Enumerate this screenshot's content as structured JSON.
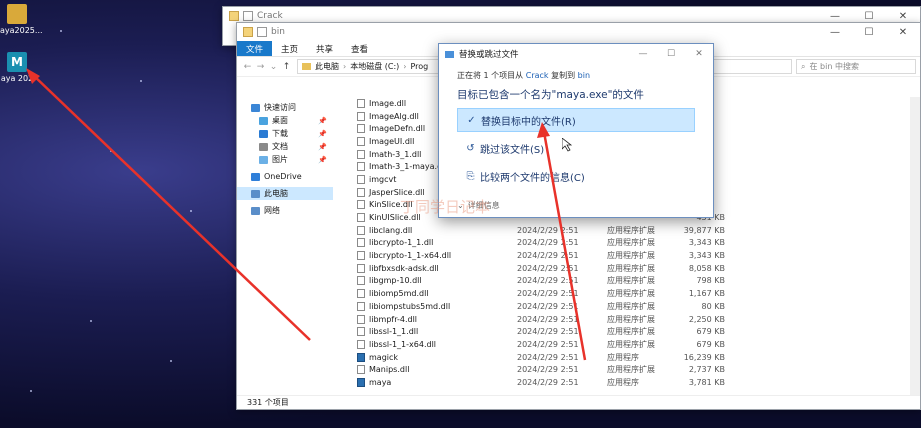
{
  "desktop": {
    "icons": [
      {
        "label": "aya2025..."
      },
      {
        "label": "aya 202"
      }
    ]
  },
  "back_window": {
    "title": "Crack"
  },
  "explorer": {
    "title": "bin",
    "ribbon_tabs": [
      "文件",
      "主页",
      "共享",
      "查看"
    ],
    "breadcrumb": [
      "此电脑",
      "本地磁盘 (C:)",
      "Prog"
    ],
    "search_placeholder": "在 bin 中搜索",
    "sidebar": [
      {
        "label": "快速访问",
        "sub": false,
        "pin": false,
        "color": "#3b86d6"
      },
      {
        "label": "桌面",
        "sub": true,
        "pin": true,
        "color": "#4aa3df"
      },
      {
        "label": "下载",
        "sub": true,
        "pin": true,
        "color": "#2a7bd3"
      },
      {
        "label": "文档",
        "sub": true,
        "pin": true,
        "color": "#8a8a8a"
      },
      {
        "label": "图片",
        "sub": true,
        "pin": true,
        "color": "#6bb0e6"
      },
      {
        "label": "OneDrive",
        "sub": false,
        "pin": false,
        "color": "#2f7fd9"
      },
      {
        "label": "此电脑",
        "sub": false,
        "pin": false,
        "color": "#5a8ec9",
        "selected": true
      },
      {
        "label": "网络",
        "sub": false,
        "pin": false,
        "color": "#5a8ec9"
      }
    ],
    "files": [
      {
        "name": "Image.dll",
        "date": "",
        "type": "",
        "size": ""
      },
      {
        "name": "ImageAlg.dll",
        "date": "",
        "type": "",
        "size": ""
      },
      {
        "name": "ImageDefn.dll",
        "date": "",
        "type": "",
        "size": ""
      },
      {
        "name": "ImageUI.dll",
        "date": "",
        "type": "",
        "size": ""
      },
      {
        "name": "Imath-3_1.dll",
        "date": "",
        "type": "",
        "size": ""
      },
      {
        "name": "Imath-3_1-maya.dll",
        "date": "",
        "type": "",
        "size": ""
      },
      {
        "name": "imgcvt",
        "date": "",
        "type": "",
        "size": ""
      },
      {
        "name": "JasperSlice.dll",
        "date": "",
        "type": "",
        "size": ""
      },
      {
        "name": "KinSlice.dll",
        "date": "",
        "type": "",
        "size": ""
      },
      {
        "name": "KinUISlice.dll",
        "date": "",
        "type": "",
        "size": "431 KB"
      },
      {
        "name": "libclang.dll",
        "date": "2024/2/29 2:51",
        "type": "应用程序扩展",
        "size": "39,877 KB"
      },
      {
        "name": "libcrypto-1_1.dll",
        "date": "2024/2/29 2:51",
        "type": "应用程序扩展",
        "size": "3,343 KB"
      },
      {
        "name": "libcrypto-1_1-x64.dll",
        "date": "2024/2/29 2:51",
        "type": "应用程序扩展",
        "size": "3,343 KB"
      },
      {
        "name": "libfbxsdk-adsk.dll",
        "date": "2024/2/29 2:51",
        "type": "应用程序扩展",
        "size": "8,058 KB"
      },
      {
        "name": "libgmp-10.dll",
        "date": "2024/2/29 2:51",
        "type": "应用程序扩展",
        "size": "798 KB"
      },
      {
        "name": "libiomp5md.dll",
        "date": "2024/2/29 2:51",
        "type": "应用程序扩展",
        "size": "1,167 KB"
      },
      {
        "name": "libiompstubs5md.dll",
        "date": "2024/2/29 2:51",
        "type": "应用程序扩展",
        "size": "80 KB"
      },
      {
        "name": "libmpfr-4.dll",
        "date": "2024/2/29 2:51",
        "type": "应用程序扩展",
        "size": "2,250 KB"
      },
      {
        "name": "libssl-1_1.dll",
        "date": "2024/2/29 2:51",
        "type": "应用程序扩展",
        "size": "679 KB"
      },
      {
        "name": "libssl-1_1-x64.dll",
        "date": "2024/2/29 2:51",
        "type": "应用程序扩展",
        "size": "679 KB"
      },
      {
        "name": "magick",
        "date": "2024/2/29 2:51",
        "type": "应用程序",
        "size": "16,239 KB",
        "exe": true
      },
      {
        "name": "Manips.dll",
        "date": "2024/2/29 2:51",
        "type": "应用程序扩展",
        "size": "2,737 KB"
      },
      {
        "name": "maya",
        "date": "2024/2/29 2:51",
        "type": "应用程序",
        "size": "3,781 KB",
        "exe": true
      }
    ],
    "status": "331 个项目"
  },
  "dialog": {
    "title": "替换或跳过文件",
    "sub_prefix": "正在将 1 个项目从",
    "sub_from": "Crack",
    "sub_mid": "复制到",
    "sub_to": "bin",
    "heading": "目标已包含一个名为\"maya.exe\"的文件",
    "options": [
      {
        "label": "替换目标中的文件(R)",
        "icon": "✓"
      },
      {
        "label": "跳过该文件(S)",
        "icon": "↺"
      },
      {
        "label": "比较两个文件的信息(C)",
        "icon": "⎘"
      }
    ],
    "detail": "详细信息"
  },
  "watermark": "丁同学日记本",
  "colors": {
    "accent": "#1979ca",
    "arrow": "#e8322a"
  }
}
